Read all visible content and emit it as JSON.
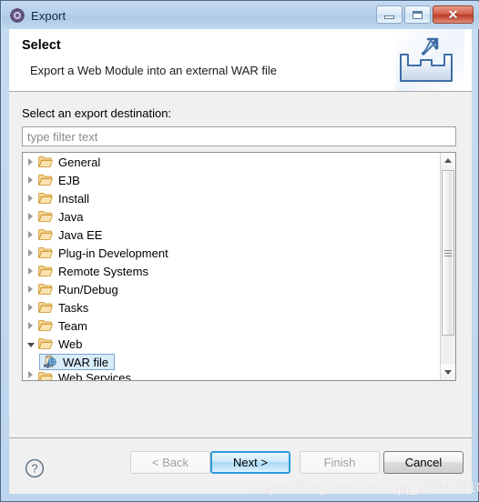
{
  "window": {
    "title": "Export",
    "title_icon": "export-gear-icon",
    "controls": {
      "minimize": "minimize-icon",
      "maximize": "maximize-icon",
      "close": "close-icon",
      "close_glyph": "✕"
    }
  },
  "header": {
    "title": "Select",
    "description": "Export a Web Module into an external WAR file",
    "icon": "export-tray-arrow-icon"
  },
  "body": {
    "destination_label": "Select an export destination:",
    "filter": {
      "value": "",
      "placeholder": "type filter text"
    },
    "tree": {
      "items": [
        {
          "label": "General",
          "expanded": false,
          "indent": 0,
          "icon": "folder-icon",
          "selected": false
        },
        {
          "label": "EJB",
          "expanded": false,
          "indent": 0,
          "icon": "folder-icon",
          "selected": false
        },
        {
          "label": "Install",
          "expanded": false,
          "indent": 0,
          "icon": "folder-icon",
          "selected": false
        },
        {
          "label": "Java",
          "expanded": false,
          "indent": 0,
          "icon": "folder-icon",
          "selected": false
        },
        {
          "label": "Java EE",
          "expanded": false,
          "indent": 0,
          "icon": "folder-icon",
          "selected": false
        },
        {
          "label": "Plug-in Development",
          "expanded": false,
          "indent": 0,
          "icon": "folder-icon",
          "selected": false
        },
        {
          "label": "Remote Systems",
          "expanded": false,
          "indent": 0,
          "icon": "folder-icon",
          "selected": false
        },
        {
          "label": "Run/Debug",
          "expanded": false,
          "indent": 0,
          "icon": "folder-icon",
          "selected": false
        },
        {
          "label": "Tasks",
          "expanded": false,
          "indent": 0,
          "icon": "folder-icon",
          "selected": false
        },
        {
          "label": "Team",
          "expanded": false,
          "indent": 0,
          "icon": "folder-icon",
          "selected": false
        },
        {
          "label": "Web",
          "expanded": true,
          "indent": 0,
          "icon": "folder-icon",
          "selected": false
        },
        {
          "label": "WAR file",
          "expanded": null,
          "indent": 1,
          "icon": "war-file-icon",
          "selected": true
        },
        {
          "label": "Web Services",
          "expanded": false,
          "indent": 0,
          "icon": "folder-icon",
          "selected": false
        }
      ],
      "scrollbar": {
        "up": "scroll-up-arrow-icon",
        "down": "scroll-down-arrow-icon"
      }
    }
  },
  "footer": {
    "help": "?",
    "buttons": [
      {
        "label": "< Back",
        "state": "disabled"
      },
      {
        "label": "Next >",
        "state": "default-focused"
      },
      {
        "label": "Finish",
        "state": "disabled"
      },
      {
        "label": "Cancel",
        "state": "enabled"
      }
    ]
  },
  "watermark": "https://blog.csdn.net/qq_42848910",
  "colors": {
    "accent": "#2f9bdb",
    "frame": "#bcd4ec",
    "selection_bg": "#d9ecfb",
    "selection_border": "#7da2ce",
    "folder": "#f0b64a"
  }
}
